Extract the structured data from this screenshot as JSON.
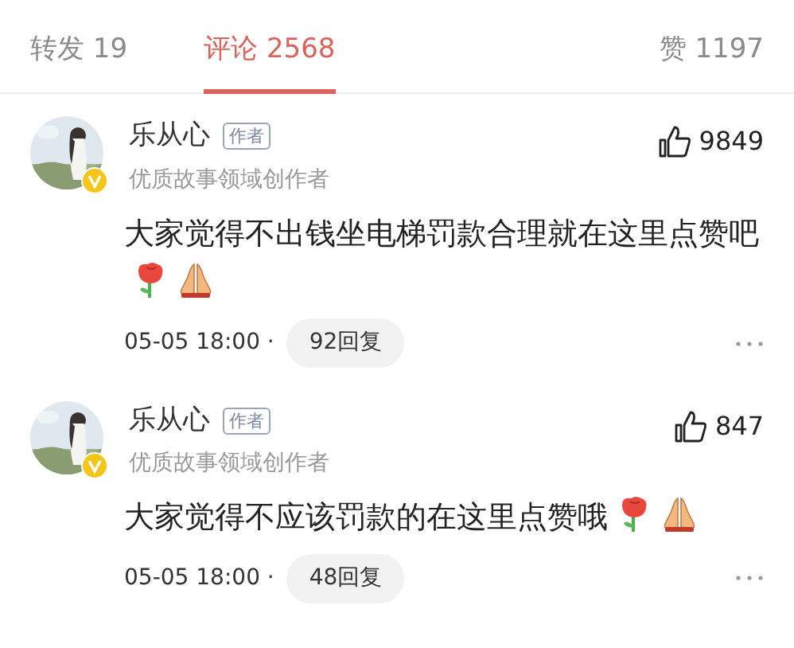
{
  "tabs": [
    {
      "label": "转发 19",
      "selected": false
    },
    {
      "label": "评论 2568",
      "selected": true
    },
    {
      "label": "赞 1197",
      "selected": false
    }
  ],
  "comments": [
    {
      "author": "乐从心",
      "badge": "作者",
      "subtitle": "优质故事领域创作者",
      "likes": "9849",
      "text": "大家觉得不出钱坐电梯罚款合理就在这里点赞吧",
      "time": "05-05 18:00 ·",
      "replies": "92回复",
      "verified": true
    },
    {
      "author": "乐从心",
      "badge": "作者",
      "subtitle": "优质故事领域创作者",
      "likes": "847",
      "text": "大家觉得不应该罚款的在这里点赞哦",
      "time": "05-05 18:00 ·",
      "replies": "48回复",
      "verified": true
    }
  ]
}
